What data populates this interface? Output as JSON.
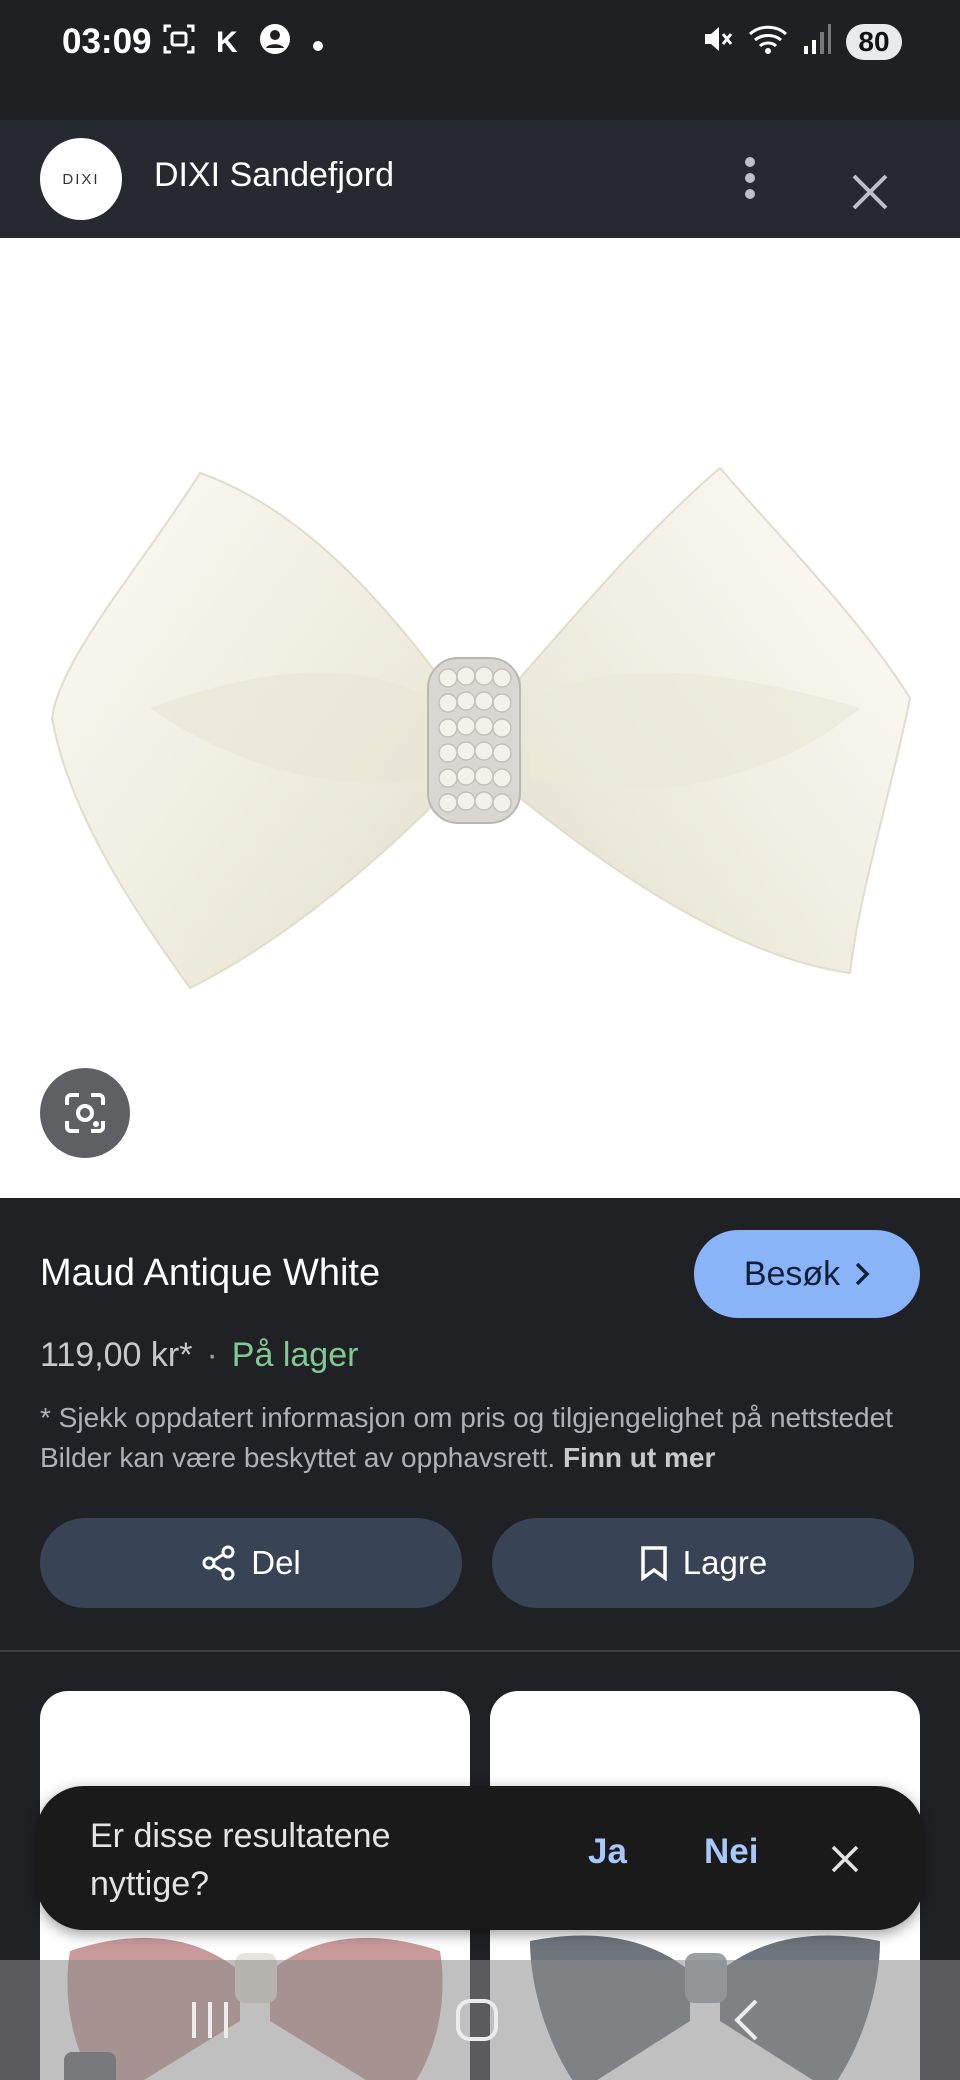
{
  "status_bar": {
    "time": "03:09",
    "left_icons": [
      "screenshot-icon",
      "k-icon",
      "account-icon",
      "dot-icon"
    ],
    "left_k": "K",
    "right_icons": [
      "mute-icon",
      "wifi-icon",
      "signal-icon"
    ],
    "battery": "80"
  },
  "header": {
    "logo_text": "DIXI",
    "site_name": "DIXI Sandefjord"
  },
  "product": {
    "title": "Maud Antique White",
    "visit_label": "Besøk",
    "price": "119,00 kr*",
    "separator": "·",
    "stock": "På lager",
    "disclaimer": "* Sjekk oppdatert informasjon om pris og tilgjengelighet på nettstedet Bilder kan være beskyttet av opphavsrett.",
    "learn_more": "Finn ut mer",
    "share_label": "Del",
    "save_label": "Lagre"
  },
  "feedback": {
    "question": "Er disse resultatene nyttige?",
    "yes": "Ja",
    "no": "Nei"
  },
  "colors": {
    "accent": "#8ab4f8",
    "stock_green": "#81c995",
    "button_bg": "#384356",
    "background": "#202124"
  }
}
